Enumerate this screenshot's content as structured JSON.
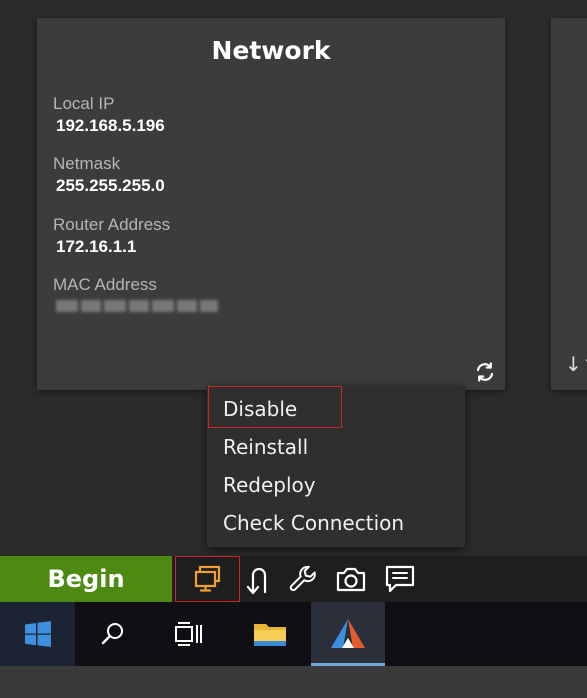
{
  "network_card": {
    "title": "Network",
    "fields": [
      {
        "label": "Local IP",
        "value": "192.168.5.196"
      },
      {
        "label": "Netmask",
        "value": "255.255.255.0"
      },
      {
        "label": "Router Address",
        "value": "172.16.1.1"
      },
      {
        "label": "MAC Address",
        "value": ""
      }
    ],
    "refresh_icon": "refresh-icon"
  },
  "next_card": {
    "icon": "sort-arrows-icon",
    "glyph": "↓↑"
  },
  "context_menu": {
    "items": [
      {
        "label": "Disable",
        "selected": true
      },
      {
        "label": "Reinstall",
        "selected": false
      },
      {
        "label": "Redeploy",
        "selected": false
      },
      {
        "label": "Check Connection",
        "selected": false
      }
    ]
  },
  "app_toolbar": {
    "begin_label": "Begin",
    "tools": [
      {
        "name": "monitor-icon",
        "active": true,
        "color": "#f0a030"
      },
      {
        "name": "undo-arrow-icon",
        "active": false
      },
      {
        "name": "wrench-icon",
        "active": false
      },
      {
        "name": "camera-icon",
        "active": false
      },
      {
        "name": "chat-icon",
        "active": false
      }
    ]
  },
  "windows_taskbar": {
    "buttons": [
      {
        "name": "windows-start-icon"
      },
      {
        "name": "search-icon"
      },
      {
        "name": "task-view-icon"
      },
      {
        "name": "file-explorer-icon"
      },
      {
        "name": "app-triangle-icon",
        "running": true
      }
    ]
  },
  "colors": {
    "begin_green": "#4c8a13",
    "highlight_red": "#c62828",
    "accent_orange": "#f0a030"
  }
}
